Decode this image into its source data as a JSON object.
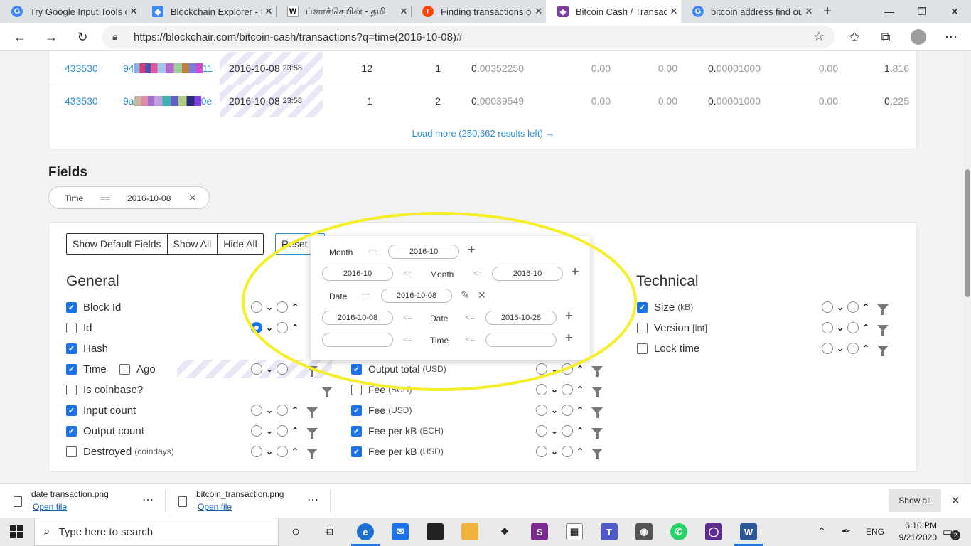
{
  "browser": {
    "tabs": [
      {
        "title": "Try Google Input Tools o",
        "favicon": "google-icon",
        "color": "#4285f4"
      },
      {
        "title": "Blockchain Explorer - Se",
        "favicon": "blockchain-icon",
        "color": "#3d89f5"
      },
      {
        "title": "ப்ளாக்செயின் - தமி",
        "favicon": "wikipedia-icon",
        "color": "#333333"
      },
      {
        "title": "Finding transactions on",
        "favicon": "reddit-icon",
        "color": "#ff4500"
      },
      {
        "title": "Bitcoin Cash / Transacti",
        "favicon": "blockchair-icon",
        "color": "#7b3fa0"
      },
      {
        "title": "bitcoin address find out",
        "favicon": "google-icon",
        "color": "#4285f4"
      }
    ],
    "url": "https://blockchair.com/bitcoin-cash/transactions?q=time(2016-10-08)#"
  },
  "table": {
    "rows": [
      {
        "block": "433530",
        "hash_start": "94",
        "hash_end": "11",
        "date": "2016-10-08",
        "time": "23:58",
        "inputs": "12",
        "outputs": "1",
        "total_dim": "0.",
        "total": "00352250",
        "v1": "0.00",
        "v2": "0.00",
        "fee_dim": "0.",
        "fee": "00001000",
        "v3": "0.00",
        "size_dim": "1.",
        "size": "816"
      },
      {
        "block": "433530",
        "hash_start": "9a",
        "hash_end": "0e",
        "date": "2016-10-08",
        "time": "23:58",
        "inputs": "1",
        "outputs": "2",
        "total_dim": "0.",
        "total": "00039549",
        "v1": "0.00",
        "v2": "0.00",
        "fee_dim": "0.",
        "fee": "00001000",
        "v3": "0.00",
        "size_dim": "0.",
        "size": "225"
      }
    ],
    "load_more": "Load more (250,662 results left) →"
  },
  "fields_title": "Fields",
  "filter": {
    "label": "Time",
    "op": "==",
    "value": "2016-10-08"
  },
  "buttons": {
    "show_default": "Show Default Fields",
    "show_all": "Show All",
    "hide_all": "Hide All",
    "reset": "Reset s"
  },
  "general": {
    "title": "General",
    "items": [
      {
        "label": "Block Id",
        "checked": true
      },
      {
        "label": "Id",
        "checked": false
      },
      {
        "label": "Hash",
        "checked": true
      },
      {
        "label": "Time",
        "checked": true
      },
      {
        "label": "Ago",
        "checked": false
      },
      {
        "label": "Is coinbase?",
        "checked": false
      },
      {
        "label": "Input count",
        "checked": true
      },
      {
        "label": "Output count",
        "checked": true
      },
      {
        "label": "Destroyed",
        "sub": "(coindays)",
        "checked": false
      }
    ]
  },
  "middle": {
    "items": [
      {
        "label": "Output total",
        "sub": "(USD)",
        "checked": true
      },
      {
        "label": "Fee",
        "sub": "(BCH)",
        "checked": false
      },
      {
        "label": "Fee",
        "sub": "(USD)",
        "checked": true
      },
      {
        "label": "Fee per kB",
        "sub": "(BCH)",
        "checked": true
      },
      {
        "label": "Fee per kB",
        "sub": "(USD)",
        "checked": true
      }
    ]
  },
  "technical": {
    "title": "Technical",
    "items": [
      {
        "label": "Size",
        "sub": "(kB)",
        "checked": true
      },
      {
        "label": "Version",
        "sub": "[int]",
        "checked": false
      },
      {
        "label": "Lock time",
        "checked": false
      }
    ]
  },
  "popup": {
    "month_label": "Month",
    "month_value": "2016-10",
    "month_from": "2016-10",
    "month_to": "2016-10",
    "date_label": "Date",
    "date_value": "2016-10-08",
    "date_from": "2016-10-08",
    "date_to": "2016-10-28",
    "time_label": "Time",
    "eq": "==",
    "le": "<="
  },
  "downloads": [
    {
      "name": "date transaction.png",
      "action": "Open file"
    },
    {
      "name": "bitcoin_transaction.png",
      "action": "Open file"
    }
  ],
  "show_all": "Show all",
  "taskbar": {
    "search_placeholder": "Type here to search",
    "lang": "ENG",
    "time": "6:10 PM",
    "date": "9/21/2020",
    "notif_count": "2"
  },
  "colors": {
    "accent": "#2d8fd0",
    "checkbox": "#1a73e8",
    "highlight_ellipse": "#f5ef2a"
  }
}
